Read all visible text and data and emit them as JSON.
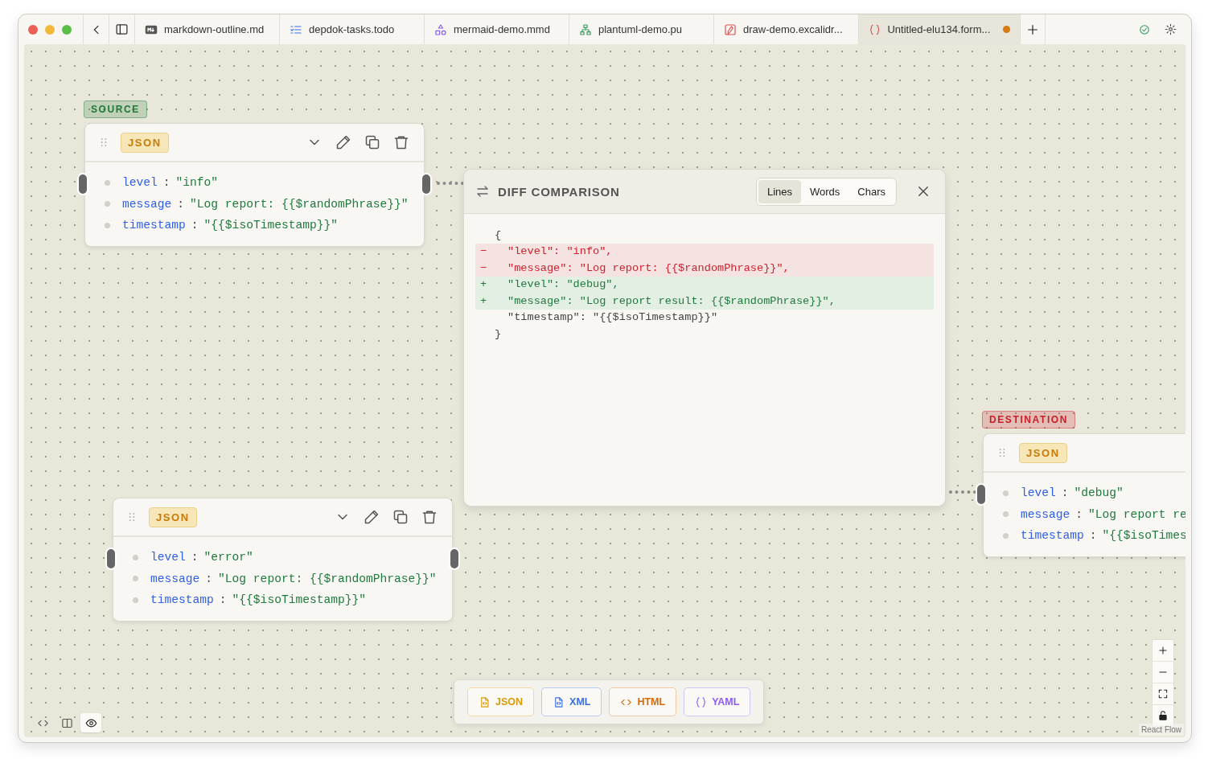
{
  "tabs": [
    {
      "label": "markdown-outline.md",
      "kind": "markdown",
      "selected": false,
      "modified": false
    },
    {
      "label": "depdok-tasks.todo",
      "kind": "todo",
      "selected": false,
      "modified": false
    },
    {
      "label": "mermaid-demo.mmd",
      "kind": "mermaid",
      "selected": false,
      "modified": false
    },
    {
      "label": "plantuml-demo.pu",
      "kind": "plantuml",
      "selected": false,
      "modified": false
    },
    {
      "label": "draw-demo.excalidr...",
      "kind": "excalidraw",
      "selected": false,
      "modified": false
    },
    {
      "label": "Untitled-elu134.form...",
      "kind": "braces",
      "selected": true,
      "modified": true
    }
  ],
  "nodes": [
    {
      "badge": "SOURCE",
      "color": "#1e7a36",
      "format": "JSON",
      "actions": true,
      "fields": [
        {
          "key": "level",
          "sep": ":",
          "value": "\"info\""
        },
        {
          "key": "message",
          "sep": ":",
          "value": "\"Log report: {{$randomPhrase}}\""
        },
        {
          "key": "timestamp",
          "sep": ":",
          "value": "\"{{$isoTimestamp}}\""
        }
      ]
    },
    {
      "format": "JSON",
      "actions": true,
      "fields": [
        {
          "key": "level",
          "sep": ":",
          "value": "\"error\""
        },
        {
          "key": "message",
          "sep": ":",
          "value": "\"Log report: {{$randomPhrase}}\""
        },
        {
          "key": "timestamp",
          "sep": ":",
          "value": "\"{{$isoTimestamp}}\""
        }
      ]
    },
    {
      "badge": "DESTINATION",
      "color": "#c81e2a",
      "format": "JSON",
      "actions": false,
      "fields": [
        {
          "key": "level",
          "sep": ":",
          "value": "\"debug\""
        },
        {
          "key": "message",
          "sep": ":",
          "value": "\"Log report re"
        },
        {
          "key": "timestamp",
          "sep": ":",
          "value": "\"{{$isoTimes"
        }
      ]
    }
  ],
  "diff": {
    "title": "DIFF COMPARISON",
    "modes": [
      {
        "label": "Lines",
        "selected": true
      },
      {
        "label": "Words",
        "selected": false
      },
      {
        "label": "Chars",
        "selected": false
      }
    ],
    "lines": [
      {
        "kind": "bracket",
        "text": "{"
      },
      {
        "kind": "removed",
        "sign": "−",
        "text": "\"level\": \"info\","
      },
      {
        "kind": "removed",
        "sign": "−",
        "text": "\"message\": \"Log report: {{$randomPhrase}}\","
      },
      {
        "kind": "added",
        "sign": "+",
        "text": "\"level\": \"debug\","
      },
      {
        "kind": "added",
        "sign": "+",
        "text": "\"message\": \"Log report result: {{$randomPhrase}}\","
      },
      {
        "kind": "context",
        "text": "\"timestamp\": \"{{$isoTimestamp}}\""
      },
      {
        "kind": "bracket",
        "text": "}"
      }
    ]
  },
  "formats": [
    {
      "label": "JSON",
      "kind": "file",
      "color": "#d99a0b"
    },
    {
      "label": "XML",
      "kind": "file",
      "color": "#3b6fe6"
    },
    {
      "label": "HTML",
      "kind": "code",
      "color": "#d46a0a"
    },
    {
      "label": "YAML",
      "kind": "braces",
      "color": "#8b5cf6"
    }
  ],
  "view_modes": [
    {
      "kind": "code",
      "selected": false
    },
    {
      "kind": "split",
      "selected": false
    },
    {
      "kind": "preview",
      "selected": true
    }
  ],
  "attribution": "React Flow"
}
